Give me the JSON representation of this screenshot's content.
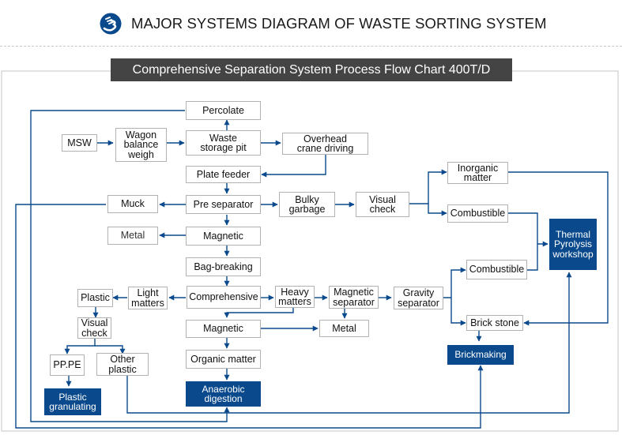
{
  "header": {
    "logo_icon": "company-logo-icon",
    "title": "MAJOR SYSTEMS DIAGRAM OF WASTE SORTING SYSTEM"
  },
  "banner": {
    "text": "Comprehensive Separation System Process Flow Chart 400T/D"
  },
  "colors": {
    "line": "#0a4a8c",
    "box_border": "#b2b2b2",
    "dark_box": "#0a4a8c",
    "banner_bg": "#444444"
  },
  "nodes": {
    "percolate": "Percolate",
    "msw": "MSW",
    "wagon": "Wagon\nbalance\nweigh",
    "waste_pit": "Waste\nstorage pit",
    "crane": "Overhead\ncrane driving",
    "plate_feeder": "Plate feeder",
    "muck": "Muck",
    "pre_separator": "Pre separator",
    "bulky": "Bulky\ngarbage",
    "visual_check_1": "Visual\ncheck",
    "inorganic": "Inorganic\nmatter",
    "combustible_1": "Combustible",
    "thermal": "Thermal\nPyrolysis\nworkshop",
    "metal_1": "Metal",
    "magnetic_1": "Magnetic",
    "bag_breaking": "Bag-breaking",
    "combustible_2": "Combustible",
    "plastic": "Plastic",
    "light": "Light\nmatters",
    "comprehensive": "Comprehensive",
    "heavy": "Heavy\nmatters",
    "mag_separator": "Magnetic\nseparator",
    "gravity": "Gravity\nseparator",
    "visual_check_2": "Visual\ncheck",
    "magnetic_2": "Magnetic",
    "metal_2": "Metal",
    "brick_stone": "Brick stone",
    "ppe": "PP.PE",
    "other_plastic": "Other\nplastic",
    "organic": "Organic matter",
    "brickmaking": "Brickmaking",
    "plastic_granulating": "Plastic\ngranulating",
    "anaerobic": "Anaerobic\ndigestion"
  }
}
